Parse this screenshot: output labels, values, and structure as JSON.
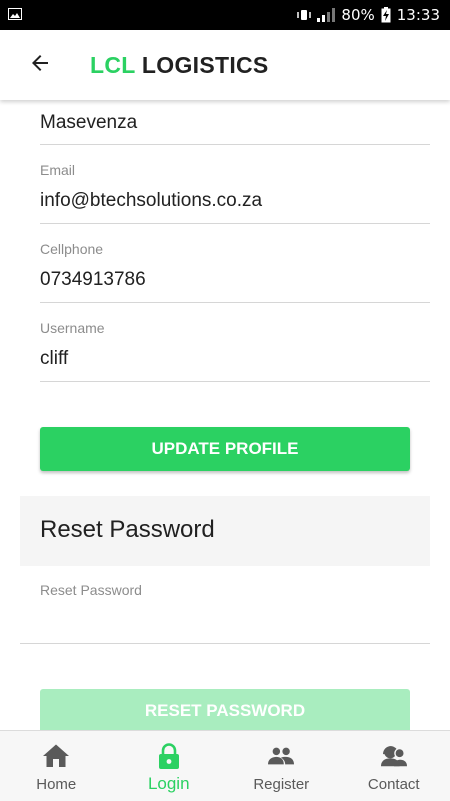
{
  "status_bar": {
    "battery": "80%",
    "time": "13:33"
  },
  "app_bar": {
    "title_brand": "LCL",
    "title_rest": "LOGISTICS",
    "back_icon": "arrow-left-icon"
  },
  "profile": {
    "surname": {
      "value": "Masevenza"
    },
    "email": {
      "label": "Email",
      "value": "info@btechsolutions.co.za"
    },
    "cellphone": {
      "label": "Cellphone",
      "value": "0734913786"
    },
    "username": {
      "label": "Username",
      "value": "cliff"
    },
    "update_button": "UPDATE PROFILE"
  },
  "reset": {
    "title": "Reset Password",
    "field_label": "Reset Password",
    "field_value": "",
    "button": "RESET PASSWORD"
  },
  "bottom_nav": {
    "items": [
      {
        "label": "Home",
        "icon": "home-icon"
      },
      {
        "label": "Login",
        "icon": "lock-icon",
        "active": true
      },
      {
        "label": "Register",
        "icon": "people-icon"
      },
      {
        "label": "Contact",
        "icon": "contact-icon"
      }
    ]
  },
  "colors": {
    "accent": "#2bd162",
    "accent_disabled": "#a9edbf",
    "text": "#212121",
    "label": "#8c8c8c",
    "nav_icon": "#5a5a5a"
  }
}
